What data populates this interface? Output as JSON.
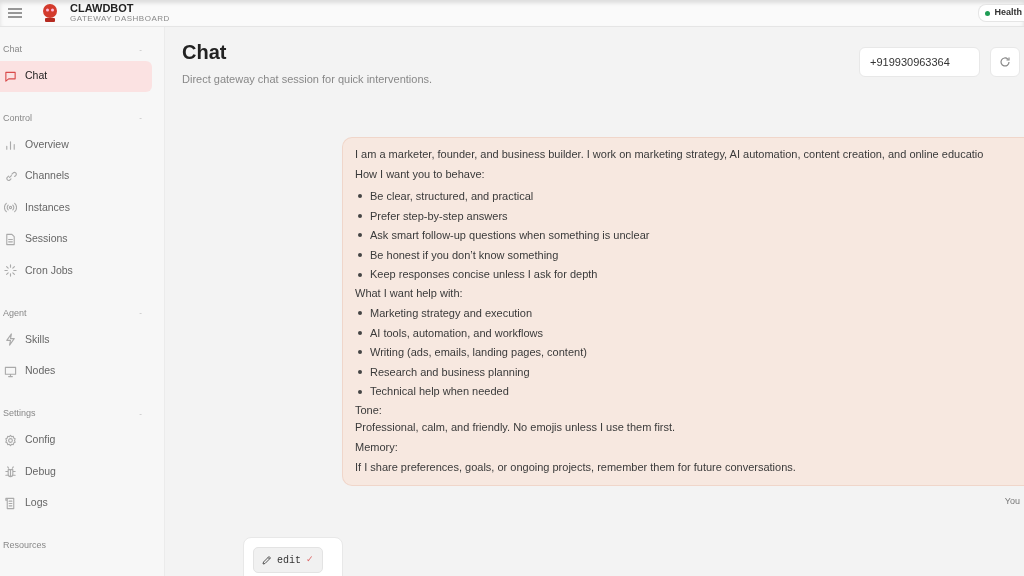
{
  "header": {
    "title": "CLAWDBOT",
    "subtitle": "GATEWAY DASHBOARD",
    "health": "Health"
  },
  "sidebar": {
    "groups": [
      {
        "label": "Chat",
        "toggle": "-",
        "items": [
          {
            "label": "Chat",
            "selected": true
          }
        ]
      },
      {
        "label": "Control",
        "toggle": "-",
        "items": [
          {
            "label": "Overview",
            "selected": false
          },
          {
            "label": "Channels",
            "selected": false
          },
          {
            "label": "Instances",
            "selected": false
          },
          {
            "label": "Sessions",
            "selected": false
          },
          {
            "label": "Cron Jobs",
            "selected": false
          }
        ]
      },
      {
        "label": "Agent",
        "toggle": "-",
        "items": [
          {
            "label": "Skills",
            "selected": false
          },
          {
            "label": "Nodes",
            "selected": false
          }
        ]
      },
      {
        "label": "Settings",
        "toggle": "-",
        "items": [
          {
            "label": "Config",
            "selected": false
          },
          {
            "label": "Debug",
            "selected": false
          },
          {
            "label": "Logs",
            "selected": false
          }
        ]
      },
      {
        "label": "Resources"
      }
    ]
  },
  "page": {
    "title": "Chat",
    "subtitle": "Direct gateway chat session for quick interventions.",
    "session_field": {
      "value": "+919930963364"
    }
  },
  "message": {
    "sender": "You",
    "blocks": [
      {
        "kind": "para",
        "text": "I am a marketer, founder, and business builder. I work on marketing strategy, AI automation, content creation, and online educatio"
      },
      {
        "kind": "para",
        "text": "How I want you to behave:"
      },
      {
        "kind": "list",
        "items": [
          "Be clear, structured, and practical",
          "Prefer step-by-step answers",
          "Ask smart follow-up questions when something is unclear",
          "Be honest if you don’t know something",
          "Keep responses concise unless I ask for depth"
        ]
      },
      {
        "kind": "line",
        "text": "What I want help with:"
      },
      {
        "kind": "list",
        "items": [
          "Marketing strategy and execution",
          "AI tools, automation, and workflows",
          "Writing (ads, emails, landing pages, content)",
          "Research and business planning",
          "Technical help when needed"
        ]
      },
      {
        "kind": "line",
        "text": "Tone:"
      },
      {
        "kind": "line",
        "text": "Professional, calm, and friendly. No emojis unless I use them first."
      },
      {
        "kind": "para",
        "text": "Memory:"
      },
      {
        "kind": "line",
        "text": "If I share preferences, goals, or ongoing projects, remember them for future conversations."
      }
    ]
  },
  "edit_button": {
    "label": "edit",
    "mark": "✓"
  }
}
